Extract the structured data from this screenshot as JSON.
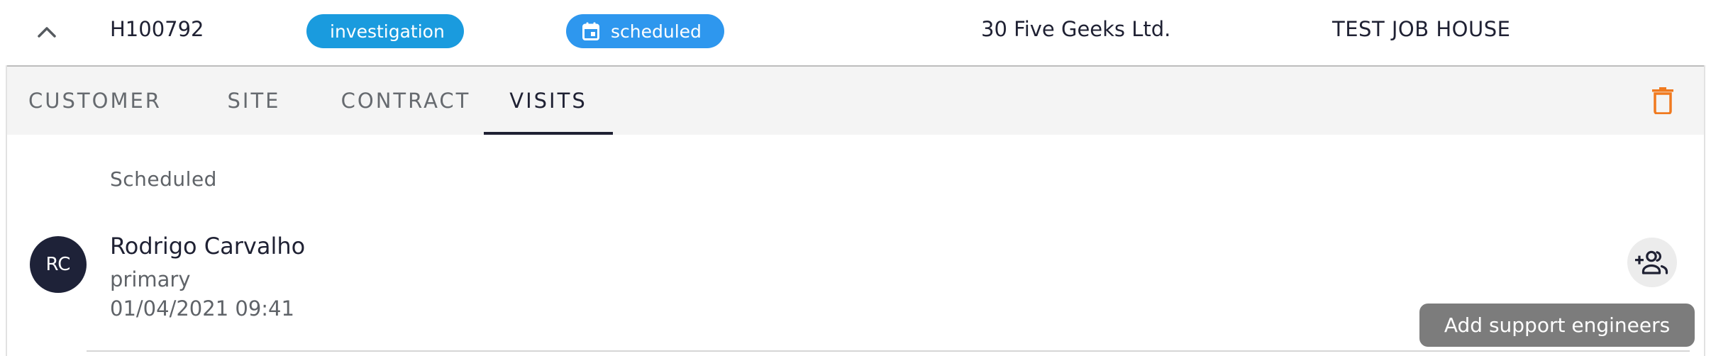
{
  "job": {
    "id": "H100792",
    "type_chip": "investigation",
    "status_chip": "scheduled",
    "customer": "30 Five Geeks Ltd.",
    "site": "TEST JOB HOUSE"
  },
  "tabs": [
    {
      "label": "CUSTOMER"
    },
    {
      "label": "SITE"
    },
    {
      "label": "CONTRACT"
    },
    {
      "label": "VISITS",
      "active": true
    }
  ],
  "visits": {
    "section_label": "Scheduled",
    "engineer": {
      "initials": "RC",
      "name": "Rodrigo Carvalho",
      "role": "primary",
      "datetime": "01/04/2021 09:41"
    },
    "add_support_tooltip": "Add support engineers"
  },
  "icons": {
    "collapse": "chevron-up-icon",
    "status": "calendar-icon",
    "delete": "trash-icon",
    "add_support": "group-add-icon"
  },
  "colors": {
    "type_chip": "#1a9bde",
    "status_chip": "#2e97ee",
    "delete_icon": "#f07a1f",
    "avatar": "#1e2238",
    "active_tab": "#1f2133",
    "tooltip": "#7c7c7c"
  }
}
